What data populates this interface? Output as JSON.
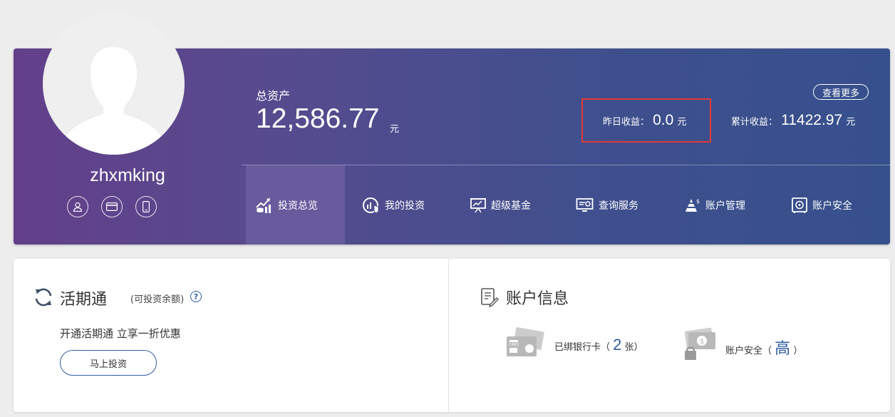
{
  "profile": {
    "username": "zhxmking",
    "icons": [
      "user-icon",
      "card-icon",
      "phone-icon"
    ]
  },
  "assets": {
    "total_label": "总资产",
    "total_value": "12,586.77",
    "unit": "元",
    "more_label": "查看更多",
    "yesterday_label": "昨日收益：",
    "yesterday_value": "0.0",
    "cumulative_label": "累计收益：",
    "cumulative_value": "11422.97"
  },
  "nav": {
    "items": [
      {
        "label": "投资总览",
        "icon": "chart-growth-icon",
        "active": true
      },
      {
        "label": "我的投资",
        "icon": "investment-icon",
        "active": false
      },
      {
        "label": "超级基金",
        "icon": "presentation-icon",
        "active": false
      },
      {
        "label": "查询服务",
        "icon": "monitor-search-icon",
        "active": false
      },
      {
        "label": "账户管理",
        "icon": "pyramid-icon",
        "active": false
      },
      {
        "label": "账户安全",
        "icon": "safe-icon",
        "active": false
      }
    ]
  },
  "huoqitong": {
    "title": "活期通",
    "subtitle": "(可投资余额)",
    "help": "?",
    "promo": "开通活期通 立享一折优惠",
    "button": "马上投资"
  },
  "account_info": {
    "title": "账户信息",
    "bank_label": "已绑银行卡（",
    "bank_count": "2",
    "bank_unit": "张）",
    "security_label": "账户安全（",
    "security_level": "高",
    "security_close": "）"
  },
  "colors": {
    "header_gradient_start": "#633f8a",
    "header_gradient_end": "#36508d",
    "accent_blue": "#2f5d9e",
    "highlight_red": "#e03a3a"
  }
}
